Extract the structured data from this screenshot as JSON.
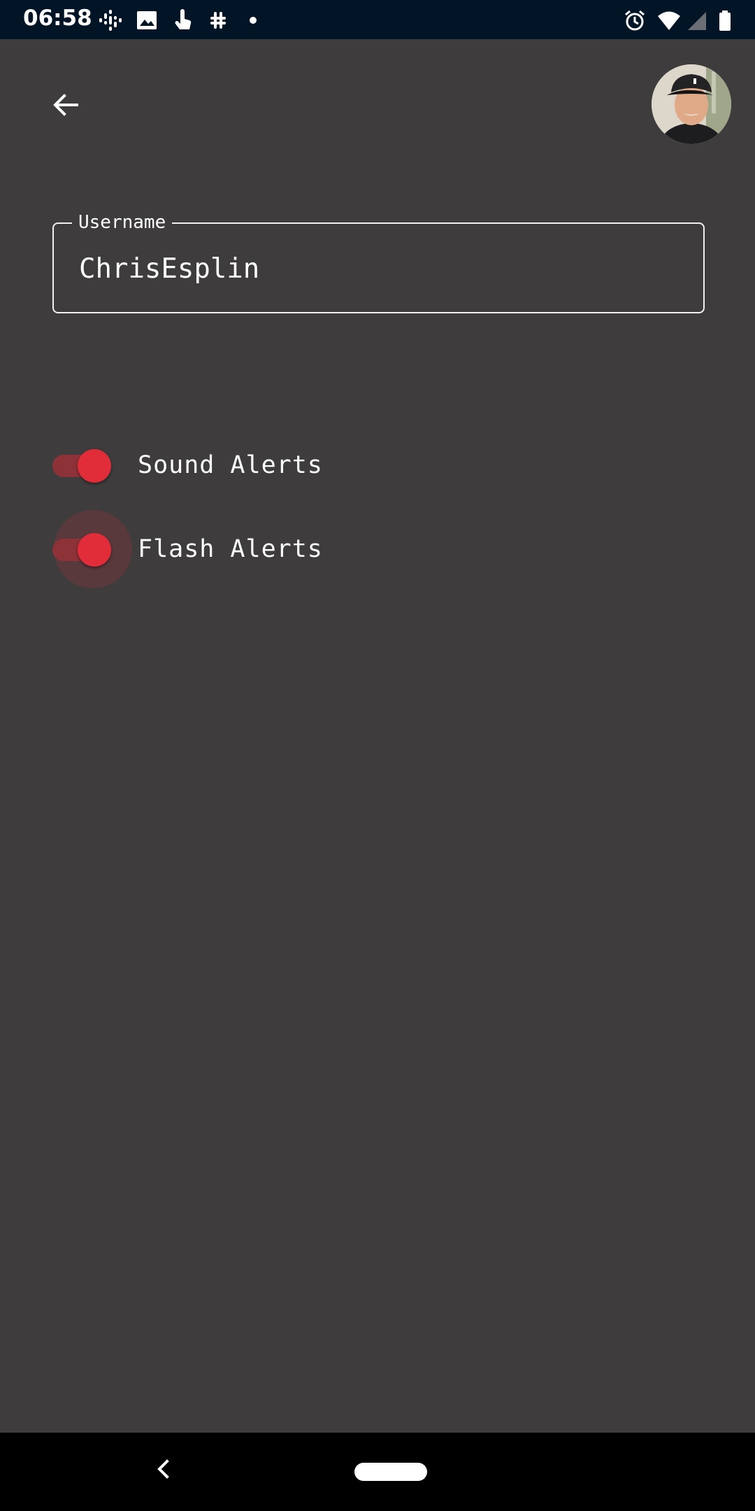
{
  "status_bar": {
    "time": "06:58",
    "notification_icons": [
      "podcast-icon",
      "image-icon",
      "touch-icon",
      "slack-icon",
      "dot-icon"
    ],
    "system_icons": [
      "alarm-icon",
      "wifi-icon",
      "signal-icon",
      "battery-icon"
    ]
  },
  "header": {
    "back_icon": "arrow-left-icon",
    "avatar_icon": "user-avatar"
  },
  "username_field": {
    "label": "Username",
    "value": "ChrisEsplin"
  },
  "settings": {
    "sound_alerts": {
      "label": "Sound Alerts",
      "enabled": true
    },
    "flash_alerts": {
      "label": "Flash Alerts",
      "enabled": true
    }
  },
  "colors": {
    "background": "#3e3c3d",
    "status_bar": "#021526",
    "accent": "#e12c39",
    "track": "#8d3338"
  },
  "nav_bar": {
    "back_icon": "chevron-left-icon",
    "home_icon": "home-pill-icon"
  }
}
